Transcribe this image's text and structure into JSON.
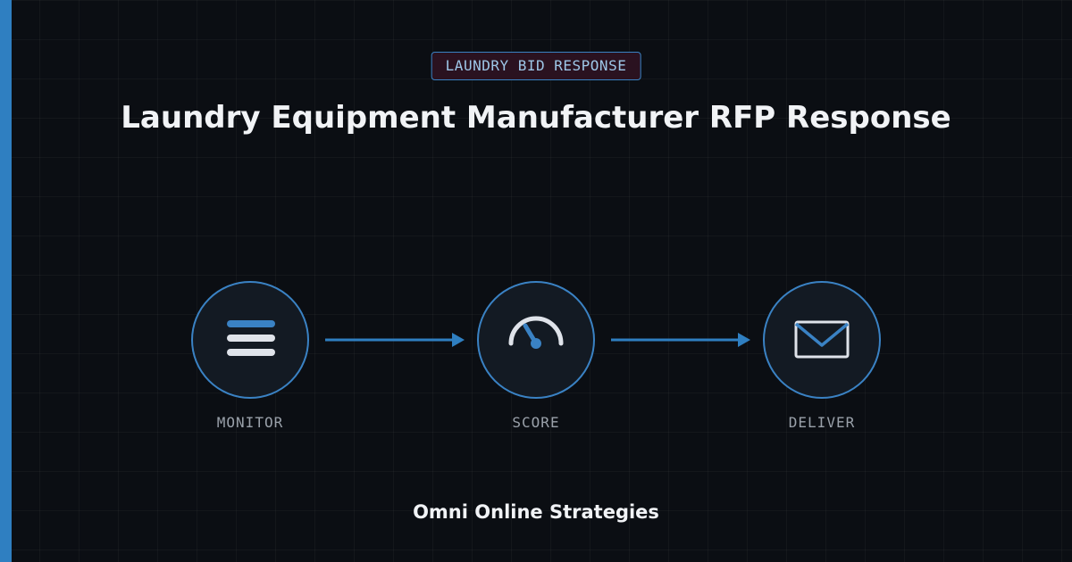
{
  "badge": {
    "label": "LAUNDRY BID RESPONSE"
  },
  "title": "Laundry Equipment Manufacturer RFP Response",
  "steps": [
    {
      "label": "MONITOR",
      "icon": "list-icon"
    },
    {
      "label": "SCORE",
      "icon": "gauge-icon"
    },
    {
      "label": "DELIVER",
      "icon": "envelope-icon"
    }
  ],
  "footer": {
    "company": "Omni Online Strategies"
  },
  "colors": {
    "background": "#0b0e13",
    "accent": "#2f7fc1",
    "circle_fill": "#131a23",
    "badge_fill": "#2a1220",
    "text": "#f1f3f6",
    "muted_text": "#9aa1aa"
  }
}
